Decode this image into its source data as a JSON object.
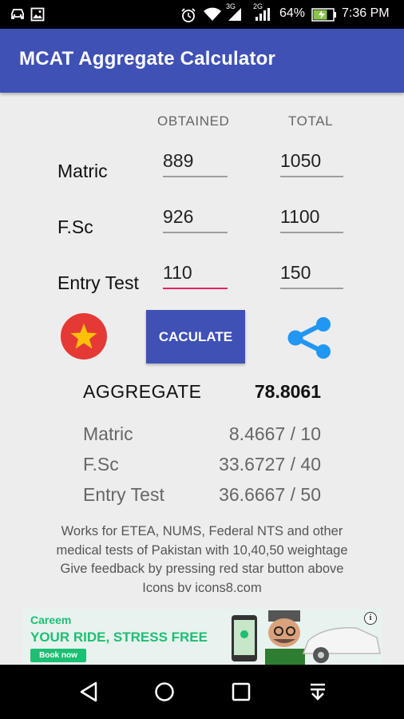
{
  "status_bar": {
    "left_icons": [
      "car-icon",
      "image-icon"
    ],
    "network_1": "3G",
    "network_2": "2G",
    "battery": "64%",
    "time": "7:36 PM"
  },
  "app": {
    "title": "MCAT Aggregate Calculator"
  },
  "columns": {
    "obtained": "OBTAINED",
    "total": "TOTAL"
  },
  "rows": [
    {
      "label": "Matric",
      "obtained": "889",
      "total": "1050"
    },
    {
      "label": "F.Sc",
      "obtained": "926",
      "total": "1100"
    },
    {
      "label": "Entry Test",
      "obtained": "110",
      "total": "150"
    }
  ],
  "actions": {
    "calculate_label": "CACULATE",
    "star_icon": "star-icon",
    "share_icon": "share-icon"
  },
  "results": {
    "aggregate_label": "AGGREGATE",
    "aggregate_value": "78.8061",
    "items": [
      {
        "label": "Matric",
        "value": "8.4667 / 10"
      },
      {
        "label": "F.Sc",
        "value": "33.6727 / 40"
      },
      {
        "label": "Entry Test",
        "value": "36.6667 / 50"
      }
    ]
  },
  "info": {
    "line1": "Works for ETEA, NUMS, Federal NTS and other",
    "line2": "medical tests of Pakistan with 10,40,50 weightage",
    "line3": "Give feedback by pressing red star button above",
    "line4": "Icons by icons8.com"
  },
  "ad": {
    "brand": "Careem",
    "tagline": "YOUR RIDE, STRESS FREE",
    "cta": "Book now",
    "info_icon": "i"
  },
  "colors": {
    "primary": "#3f51b5",
    "accent": "#e91e63",
    "star_bg": "#e53935",
    "star": "#ffc107",
    "share": "#2196f3",
    "ad_green": "#1dbf73"
  }
}
